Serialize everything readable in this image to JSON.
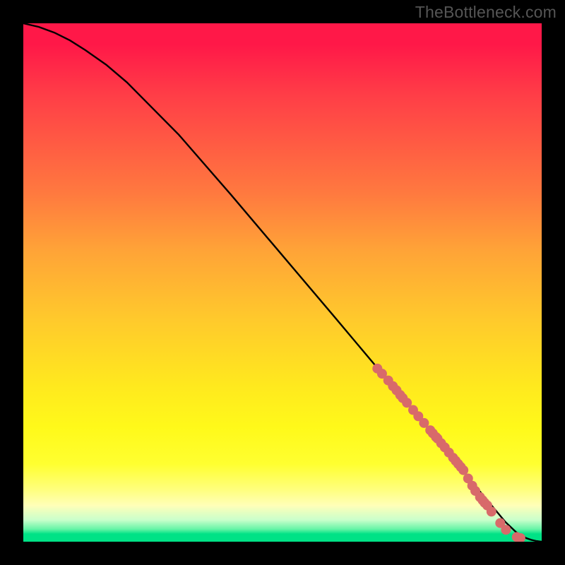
{
  "watermark": "TheBottleneck.com",
  "chart_data": {
    "type": "line",
    "title": "",
    "xlabel": "",
    "ylabel": "",
    "xlim": [
      0,
      100
    ],
    "ylim": [
      0,
      100
    ],
    "curve": {
      "name": "bottleneck-curve",
      "x": [
        0,
        3,
        6,
        9,
        12,
        16,
        20,
        30,
        40,
        50,
        60,
        70,
        78,
        82,
        85,
        88,
        91,
        93,
        95,
        96,
        97,
        98,
        99,
        100
      ],
      "y": [
        100,
        99.3,
        98.2,
        96.7,
        94.8,
        92.0,
        88.6,
        78.5,
        67.0,
        55.2,
        43.4,
        31.5,
        22.0,
        17.2,
        13.5,
        9.8,
        6.2,
        3.8,
        1.9,
        1.2,
        0.7,
        0.35,
        0.12,
        0
      ]
    },
    "points": {
      "name": "data-markers",
      "color": "#d86a6a",
      "radius": 7,
      "x": [
        68.3,
        69.2,
        70.4,
        71.3,
        72.0,
        72.7,
        73.2,
        74.0,
        75.2,
        76.2,
        77.3,
        78.5,
        79.0,
        79.6,
        79.9,
        80.6,
        81.3,
        82.1,
        82.9,
        83.4,
        83.9,
        84.4,
        84.9,
        85.8,
        86.6,
        87.2,
        88.1,
        88.6,
        89.0,
        89.5,
        90.3,
        92.0,
        93.1,
        95.2,
        95.9
      ],
      "y": [
        33.4,
        32.4,
        31.1,
        30.0,
        29.2,
        28.3,
        27.7,
        26.8,
        25.4,
        24.2,
        22.9,
        21.5,
        20.9,
        20.2,
        19.9,
        19.0,
        18.2,
        17.2,
        16.2,
        15.6,
        15.0,
        14.4,
        13.8,
        12.2,
        10.8,
        9.8,
        8.6,
        8.0,
        7.5,
        7.0,
        5.8,
        3.6,
        2.3,
        0.9,
        0.7
      ]
    },
    "gradient_stops": [
      {
        "pos": 0.0,
        "color": "#ff1848"
      },
      {
        "pos": 0.33,
        "color": "#ff7a3f"
      },
      {
        "pos": 0.7,
        "color": "#ffe91e"
      },
      {
        "pos": 0.9,
        "color": "#ffff7e"
      },
      {
        "pos": 0.985,
        "color": "#00e286"
      }
    ]
  }
}
